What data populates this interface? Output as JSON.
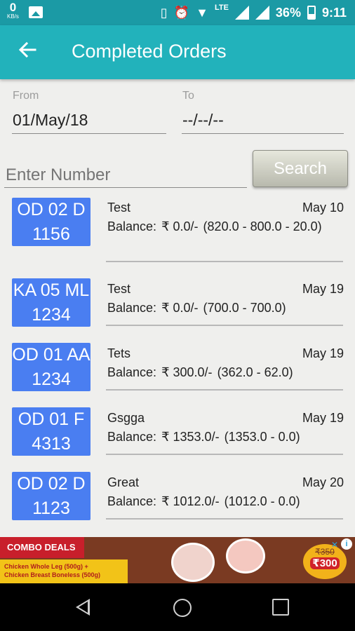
{
  "status_bar": {
    "speed_value": "0",
    "speed_unit": "KB/s",
    "lte": "LTE",
    "battery": "36%",
    "time": "9:11",
    "icons": [
      "gallery-icon",
      "vibrate-icon",
      "alarm-icon",
      "4g-icon",
      "wifi-icon",
      "signal-icon",
      "signal-icon",
      "battery-icon"
    ]
  },
  "app_bar": {
    "title": "Completed Orders"
  },
  "filters": {
    "from_label": "From",
    "from_value": "01/May/18",
    "to_label": "To",
    "to_value": "--/--/--",
    "number_placeholder": "Enter Number",
    "search_label": "Search"
  },
  "orders": [
    {
      "plate_line1": "OD 02 D",
      "plate_line2": "1156",
      "name": "Test",
      "date": "May 10",
      "balance_label": "Balance:",
      "balance": "₹ 0.0/-",
      "detail": "(820.0 - 800.0 - 20.0)"
    },
    {
      "plate_line1": "KA 05 ML",
      "plate_line2": "1234",
      "name": "Test",
      "date": "May 19",
      "balance_label": "Balance:",
      "balance": "₹ 0.0/-",
      "detail": "(700.0 - 700.0)"
    },
    {
      "plate_line1": "OD 01 AA",
      "plate_line2": "1234",
      "name": "Tets",
      "date": "May 19",
      "balance_label": "Balance:",
      "balance": "₹ 300.0/-",
      "detail": "(362.0 - 62.0)"
    },
    {
      "plate_line1": "OD 01 F",
      "plate_line2": "4313",
      "name": "Gsgga",
      "date": "May 19",
      "balance_label": "Balance:",
      "balance": "₹ 1353.0/-",
      "detail": "(1353.0 - 0.0)"
    },
    {
      "plate_line1": "OD 02 D",
      "plate_line2": "1123",
      "name": "Great",
      "date": "May 20",
      "balance_label": "Balance:",
      "balance": "₹ 1012.0/-",
      "detail": "(1012.0 - 0.0)"
    }
  ],
  "ad": {
    "tag": "COMBO DEALS",
    "line1": "Chicken Whole Leg (500g) +",
    "line2": "Chicken Breast Boneless (500g)",
    "old_price": "₹350",
    "new_price": "₹300"
  },
  "colors": {
    "status_bar": "#1b9aa5",
    "app_bar": "#22b2bb",
    "plate": "#4a7ef1"
  }
}
